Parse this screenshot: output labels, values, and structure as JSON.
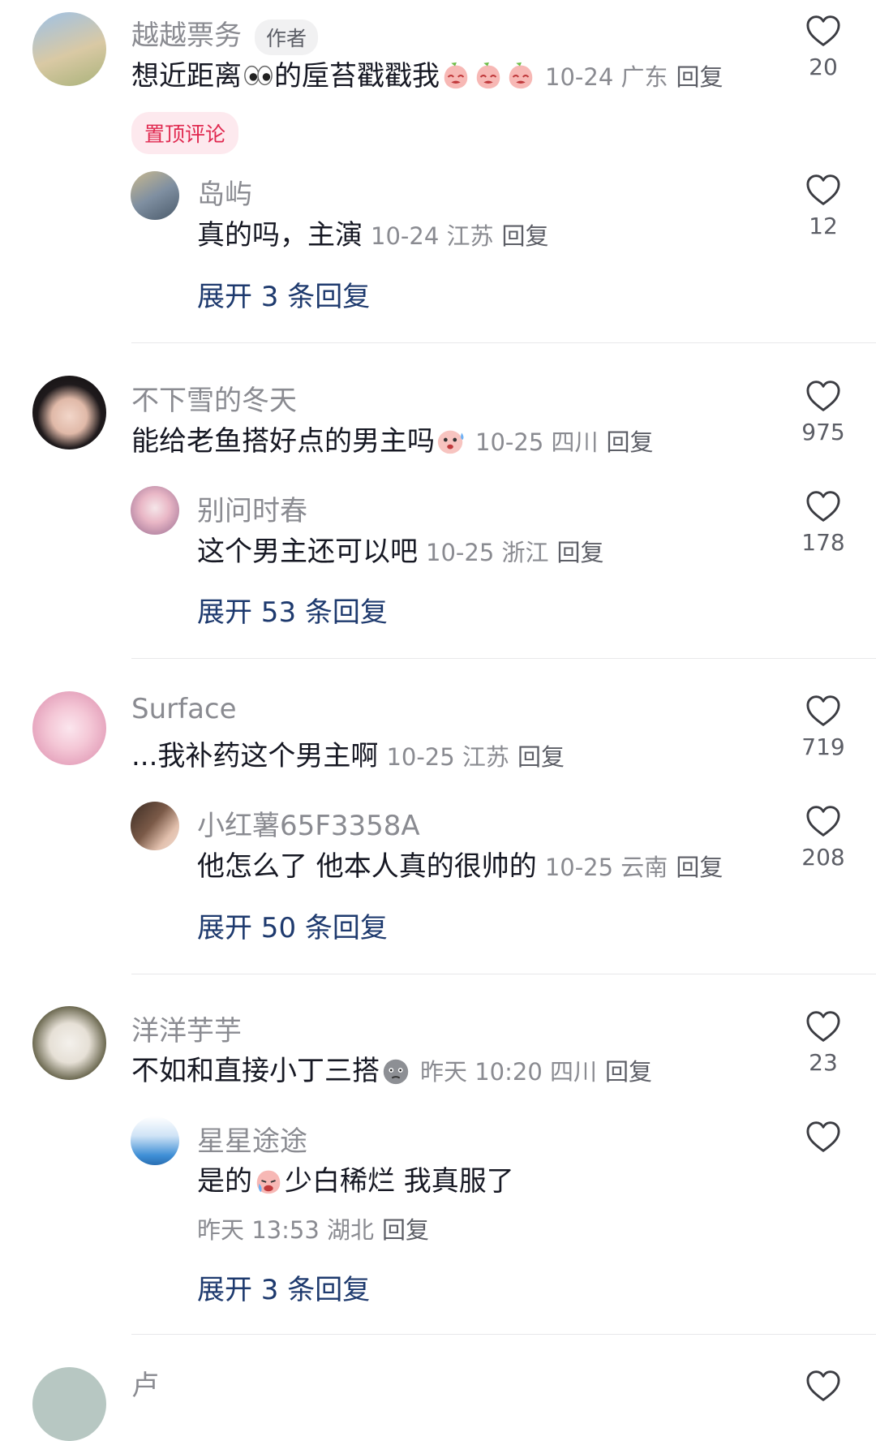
{
  "threads": [
    {
      "main": {
        "username": "越越票务",
        "author_tag": "作者",
        "text_before": "想近距离",
        "text_mid": "的垕苔戳戳我",
        "meta": "10-24 广东",
        "reply_label": "回复",
        "likes": "20",
        "pinned": "置顶评论"
      },
      "reply": {
        "username": "岛屿",
        "text": "真的吗，主演",
        "meta": "10-24 江苏",
        "reply_label": "回复",
        "likes": "12"
      },
      "expand": "展开 3 条回复"
    },
    {
      "main": {
        "username": "不下雪的冬天",
        "text": "能给老鱼搭好点的男主吗",
        "meta": "10-25 四川",
        "reply_label": "回复",
        "likes": "975"
      },
      "reply": {
        "username": "别问时春",
        "text": "这个男主还可以吧",
        "meta": "10-25 浙江",
        "reply_label": "回复",
        "likes": "178"
      },
      "expand": "展开 53 条回复"
    },
    {
      "main": {
        "username": "Surface",
        "text": "...我补药这个男主啊",
        "meta": "10-25 江苏",
        "reply_label": "回复",
        "likes": "719"
      },
      "reply": {
        "username": "小红薯65F3358A",
        "text": "他怎么了 他本人真的很帅的",
        "meta": "10-25 云南",
        "reply_label": "回复",
        "likes": "208"
      },
      "expand": "展开 50 条回复"
    },
    {
      "main": {
        "username": "洋洋芋芋",
        "text": "不如和直接小丁三搭",
        "meta": "昨天 10:20 四川",
        "reply_label": "回复",
        "likes": "23"
      },
      "reply": {
        "username": "星星途途",
        "text_before": "是的",
        "text_after": "少白稀烂 我真服了",
        "meta": "昨天 13:53 湖北",
        "reply_label": "回复",
        "likes": ""
      },
      "expand": "展开 3 条回复"
    }
  ],
  "partial_next": {
    "username": "卢"
  },
  "colors": {
    "accent_red": "#e0284f",
    "expand_blue": "#1e3a6e",
    "gray_text": "#8a8b91"
  },
  "icons": [
    "heart-outline-icon",
    "eyes-emoji-icon",
    "peach-emoji-icon",
    "sweat-emoji-icon",
    "doge-emoji-icon",
    "crying-emoji-icon"
  ]
}
